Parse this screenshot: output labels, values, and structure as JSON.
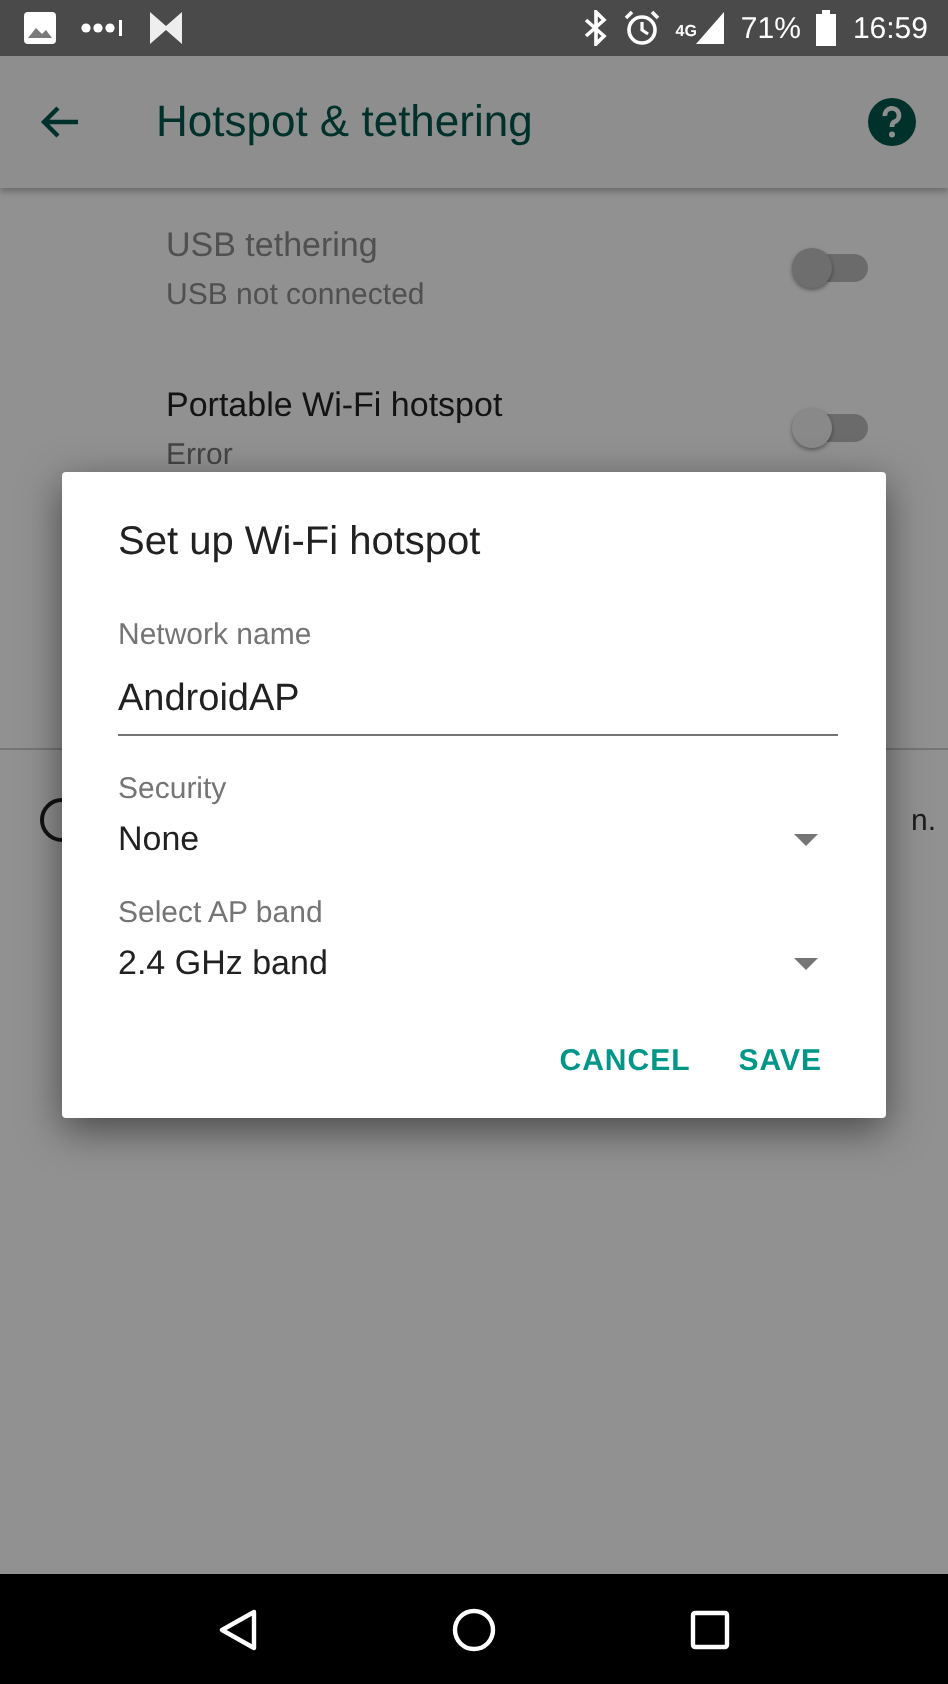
{
  "status_bar": {
    "network": "4G",
    "battery": "71%",
    "time": "16:59"
  },
  "app_bar": {
    "title": "Hotspot & tethering"
  },
  "settings": [
    {
      "title": "USB tethering",
      "subtitle": "USB not connected",
      "disabled": true,
      "on": false
    },
    {
      "title": "Portable Wi-Fi hotspot",
      "subtitle": "Error",
      "disabled": false,
      "on": false
    }
  ],
  "partial_row": {
    "text": "n."
  },
  "dialog": {
    "title": "Set up Wi-Fi hotspot",
    "fields": [
      {
        "kind": "text",
        "label": "Network name",
        "value": "AndroidAP"
      },
      {
        "kind": "dropdown",
        "label": "Security",
        "value": "None"
      },
      {
        "kind": "dropdown",
        "label": "Select AP band",
        "value": "2.4 GHz band"
      }
    ],
    "buttons": [
      "CANCEL",
      "SAVE"
    ]
  }
}
